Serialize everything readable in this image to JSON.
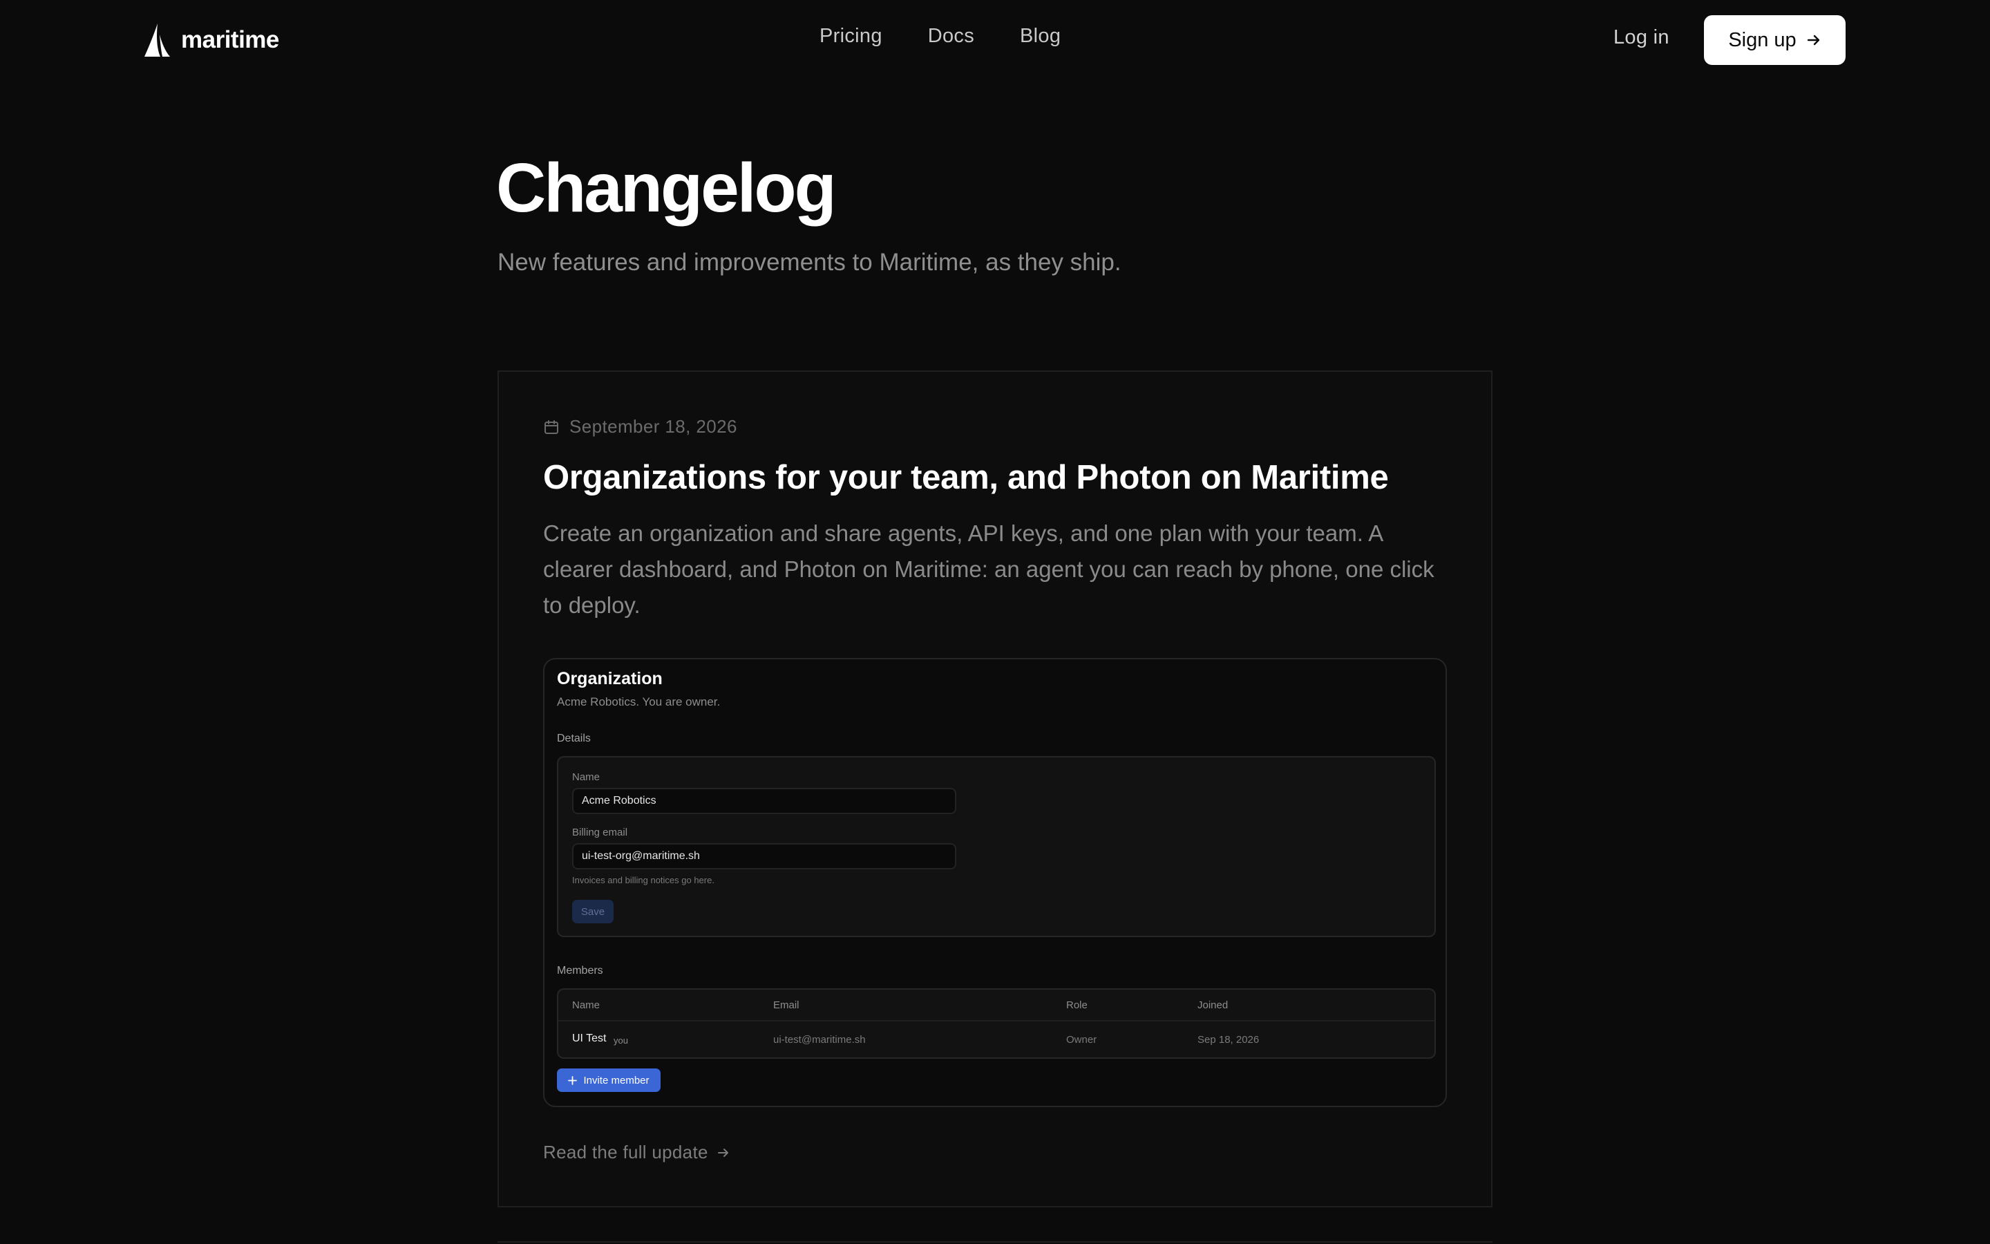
{
  "nav": {
    "brand": "maritime",
    "links": [
      "Pricing",
      "Docs",
      "Blog"
    ],
    "login": "Log in",
    "signup": "Sign up"
  },
  "hero": {
    "title": "Changelog",
    "subtitle": "New features and improvements to Maritime, as they ship."
  },
  "entry": {
    "date": "September 18, 2026",
    "title": "Organizations for your team, and Photon on Maritime",
    "body": "Create an organization and share agents, API keys, and one plan with your team. A clearer dashboard, and Photon on Maritime: an agent you can reach by phone, one click to deploy.",
    "read_more": "Read the full update"
  },
  "screenshot": {
    "title": "Organization",
    "subtitle": "Acme Robotics. You are owner.",
    "details_label": "Details",
    "name_label": "Name",
    "name_value": "Acme Robotics",
    "email_label": "Billing email",
    "email_value": "ui-test-org@maritime.sh",
    "email_hint": "Invoices and billing notices go here.",
    "save": "Save",
    "members_label": "Members",
    "columns": [
      "Name",
      "Email",
      "Role",
      "Joined"
    ],
    "member": {
      "name": "UI Test",
      "tag": "you",
      "email": "ui-test@maritime.sh",
      "role": "Owner",
      "joined": "Sep 18, 2026"
    },
    "invite": "Invite member"
  },
  "colors": {
    "background": "#0b0b0b",
    "accent": "#3a66d6",
    "text_muted": "#8a8a8a"
  }
}
